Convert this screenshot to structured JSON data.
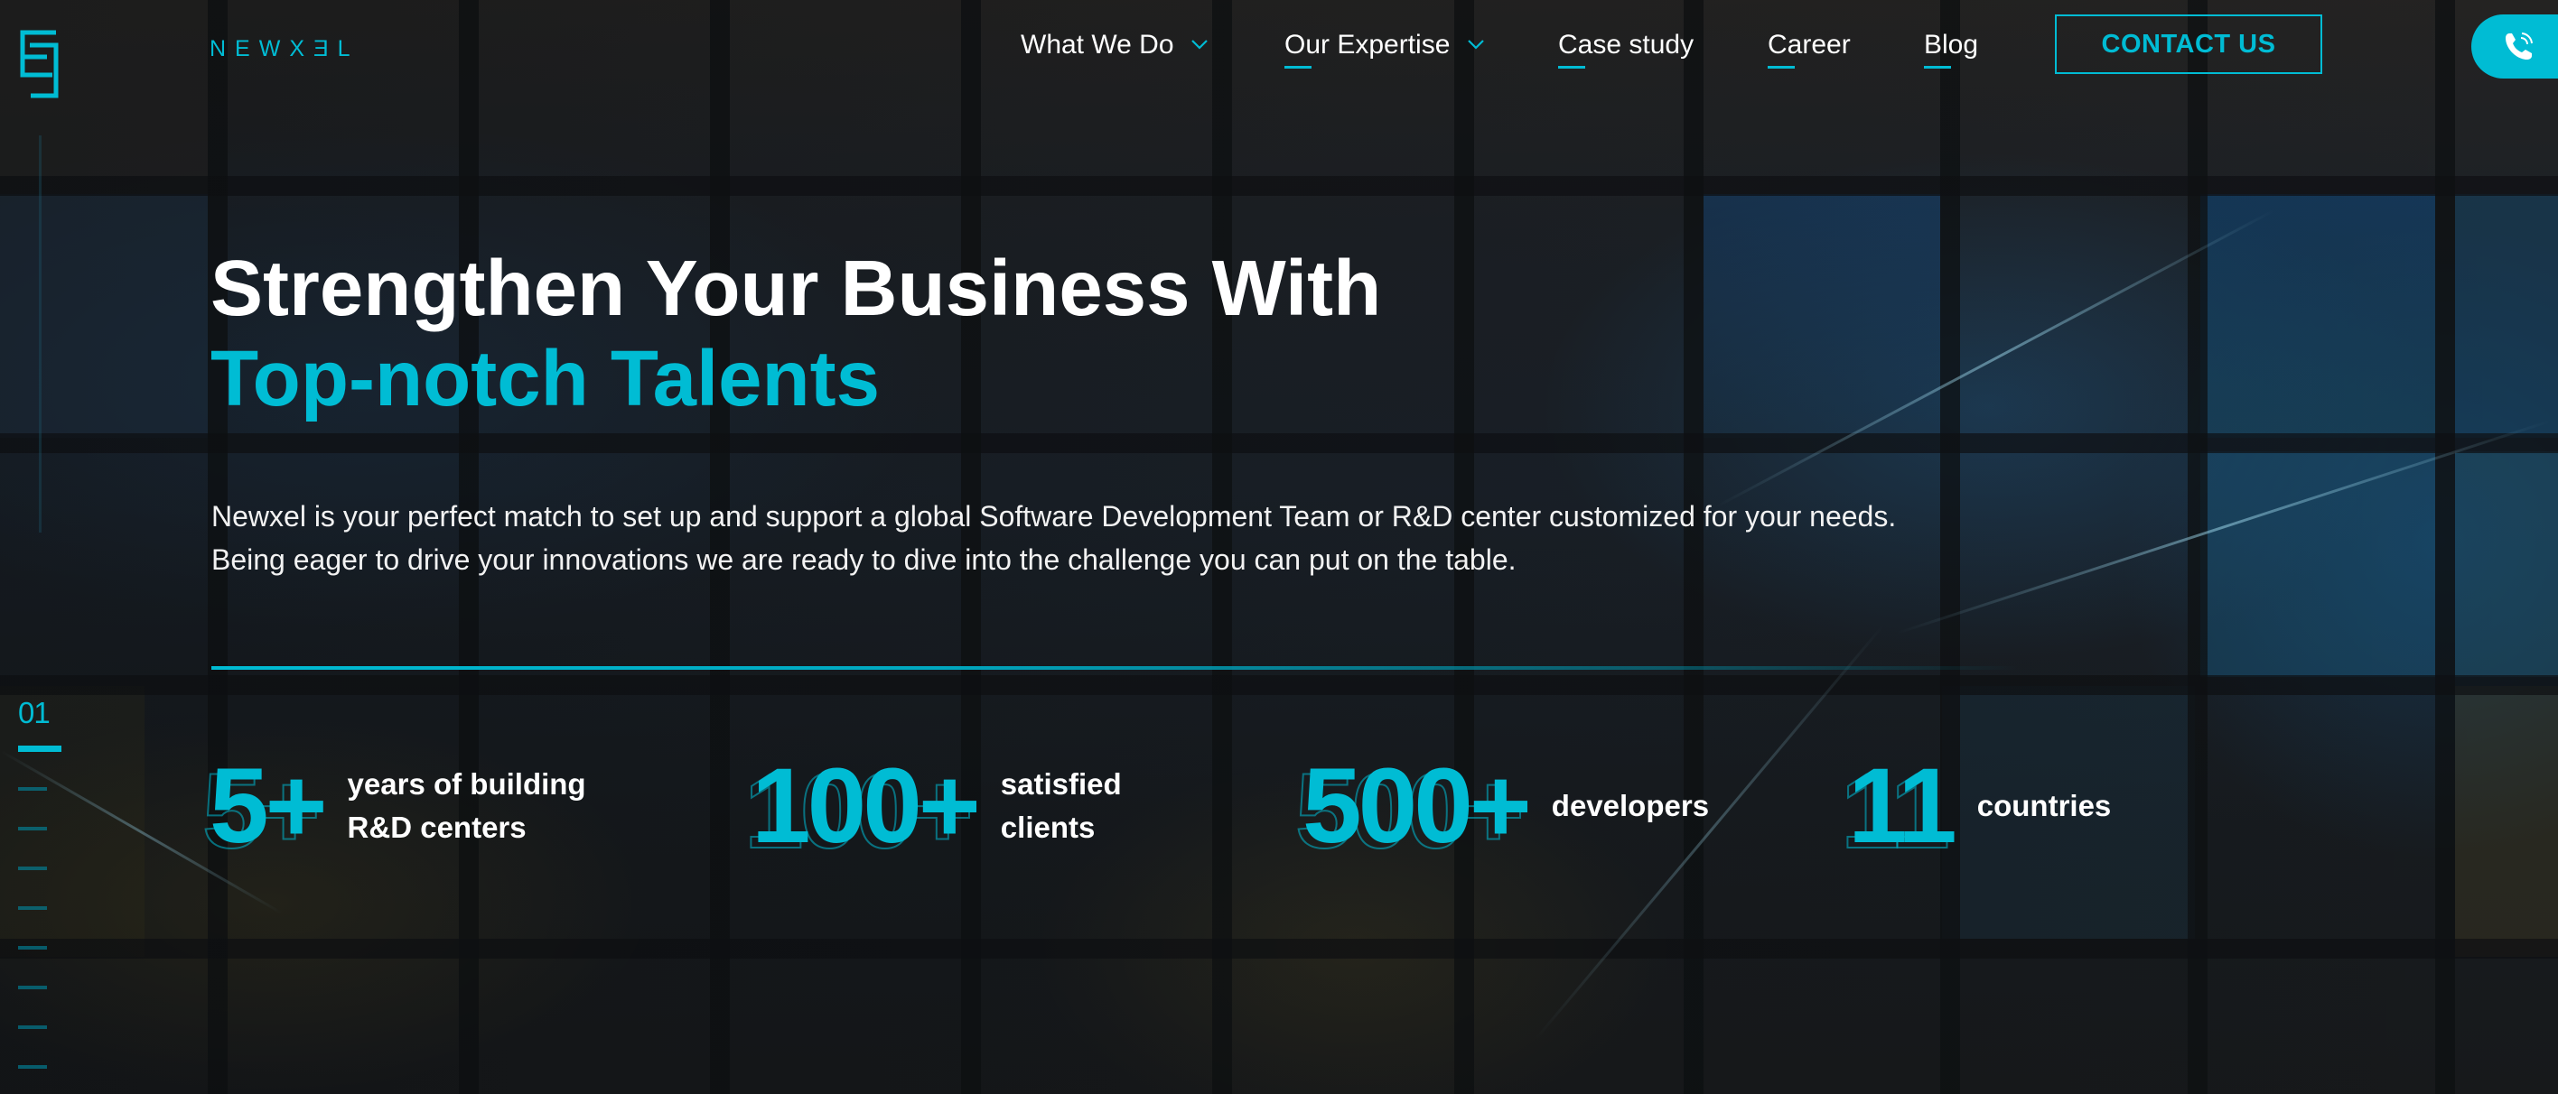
{
  "header": {
    "brand": "NEWXƎL",
    "nav": [
      {
        "label": "What We Do",
        "has_dropdown": true
      },
      {
        "label": "Our Expertise",
        "has_dropdown": true
      },
      {
        "label": "Case study",
        "has_dropdown": false
      },
      {
        "label": "Career",
        "has_dropdown": false
      },
      {
        "label": "Blog",
        "has_dropdown": false
      }
    ],
    "contact_label": "CONTACT US",
    "phone_icon": "phone-icon"
  },
  "hero": {
    "title_line1": "Strengthen Your Business With",
    "title_line2": "Top-notch Talents",
    "lead_line1": "Newxel is your perfect match to set up and support a global Software Development Team or R&D center customized for your needs.",
    "lead_line2": "Being eager to drive your innovations we are ready to dive into the challenge you can put on the table."
  },
  "stats": [
    {
      "value": "5+",
      "label_line1": "years of building",
      "label_line2": "R&D centers"
    },
    {
      "value": "100+",
      "label_line1": "satisfied",
      "label_line2": "clients"
    },
    {
      "value": "500+",
      "label_line1": "developers",
      "label_line2": ""
    },
    {
      "value": "11",
      "label_line1": "countries",
      "label_line2": ""
    }
  ],
  "pager": {
    "current": "01",
    "total_slides": 9,
    "active_index": 0
  },
  "colors": {
    "accent": "#00bcd4",
    "text": "#ffffff",
    "background": "#17191c"
  }
}
